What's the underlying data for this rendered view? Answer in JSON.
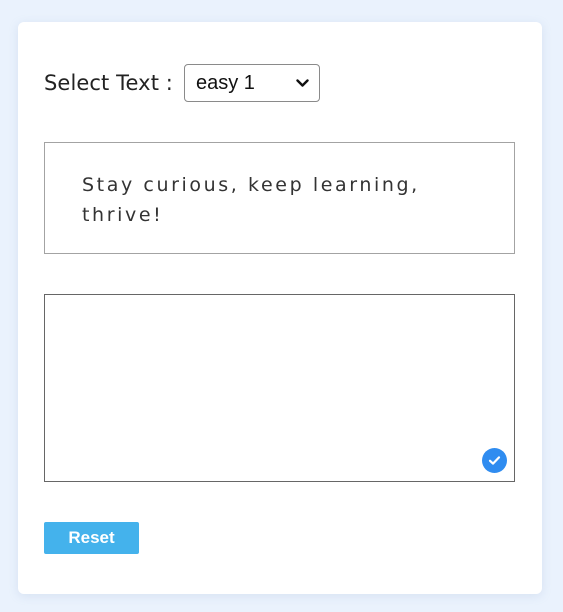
{
  "selector": {
    "label": "Select Text :",
    "selected_value": "easy 1"
  },
  "display": {
    "text": "Stay curious, keep learning, thrive!"
  },
  "typing_area": {
    "value": "",
    "status_icon": "check-circle-icon"
  },
  "actions": {
    "reset_label": "Reset"
  },
  "colors": {
    "page_background": "#eaf2fd",
    "card_background": "#ffffff",
    "reset_button": "#44b2ec",
    "check_badge": "#2f8cf0"
  }
}
